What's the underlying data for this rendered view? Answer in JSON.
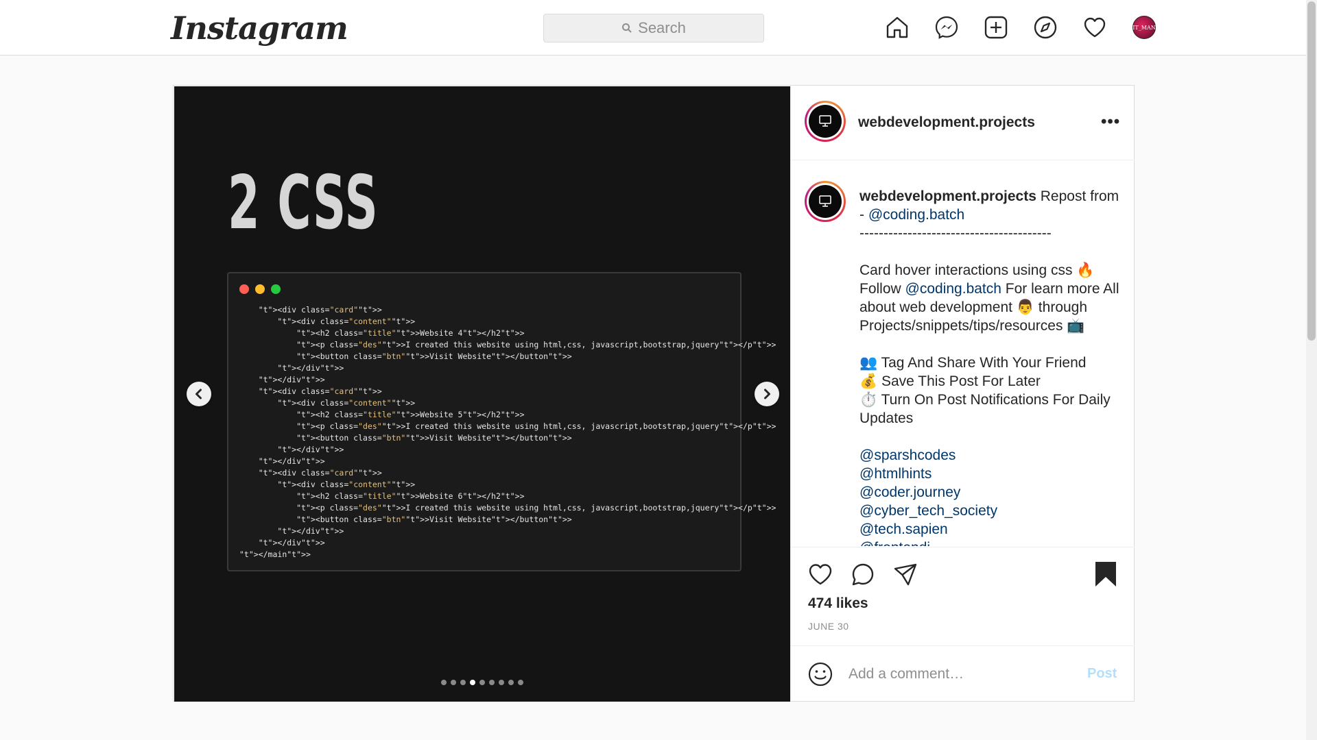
{
  "nav": {
    "logo": "Instagram",
    "search_placeholder": "Search",
    "icons": [
      "home-icon",
      "messenger-icon",
      "new-post-icon",
      "explore-icon",
      "activity-heart-icon",
      "profile-avatar"
    ],
    "avatar_text": "IT_MAN"
  },
  "media": {
    "title": "2 CSS",
    "code_lines": [
      "    <div class=\"card\">",
      "        <div class=\"content\">",
      "            <h2 class=\"title\">Website 4</h2>",
      "            <p class=\"des\">I created this website using html,css, javascript,bootstrap,jquery</p>",
      "            <button class=\"btn\">Visit Website</button>",
      "        </div>",
      "    </div>",
      "    <div class=\"card\">",
      "        <div class=\"content\">",
      "            <h2 class=\"title\">Website 5</h2>",
      "            <p class=\"des\">I created this website using html,css, javascript,bootstrap,jquery</p>",
      "            <button class=\"btn\">Visit Website</button>",
      "        </div>",
      "    </div>",
      "    <div class=\"card\">",
      "        <div class=\"content\">",
      "            <h2 class=\"title\">Website 6</h2>",
      "            <p class=\"des\">I created this website using html,css, javascript,bootstrap,jquery</p>",
      "            <button class=\"btn\">Visit Website</button>",
      "        </div>",
      "    </div>",
      "</main>"
    ],
    "carousel_total": 9,
    "carousel_active_index": 3,
    "window_dot_colors": [
      "#ff5f56",
      "#ffbd2e",
      "#27c93f"
    ]
  },
  "post": {
    "username": "webdevelopment.projects",
    "more_label": "•••",
    "caption": {
      "username": "webdevelopment.projects",
      "intro": "Repost from - ",
      "intro_mention": "@coding.batch",
      "divider": "----------------------------------------",
      "line1": "Card hover interactions using css 🔥",
      "line2_pre": "Follow ",
      "line2_mention": "@coding.batch",
      "line2_post": " For learn more All about web development 👨 through Projects/snippets/tips/resources 📺",
      "bullet1": "👥 Tag And Share With Your Friend",
      "bullet2": "💰 Save This Post For Later",
      "bullet3": "⏱️ Turn On Post Notifications For Daily Updates",
      "mentions": [
        "@sparshcodes",
        "@htmlhints",
        "@coder.journey",
        "@cyber_tech_society",
        "@tech.sapien",
        "@frontendi"
      ]
    },
    "likes": "474 likes",
    "date": "JUNE 30",
    "comment_placeholder": "Add a comment…",
    "post_button": "Post"
  },
  "colors": {
    "link": "#00376b",
    "post_button_disabled": "#b2dffc"
  }
}
